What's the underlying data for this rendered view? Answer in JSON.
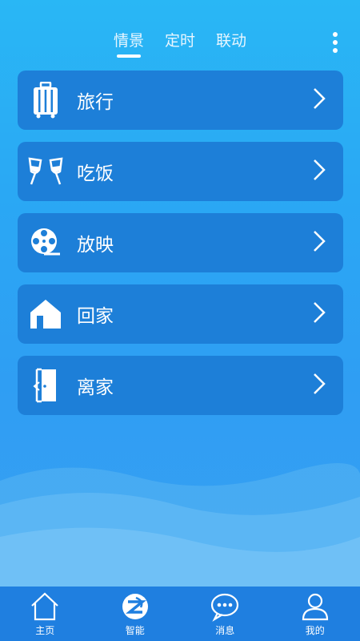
{
  "tabs": [
    {
      "label": "情景",
      "active": true
    },
    {
      "label": "定时",
      "active": false
    },
    {
      "label": "联动",
      "active": false
    }
  ],
  "scenes": [
    {
      "label": "旅行",
      "icon": "luggage-icon"
    },
    {
      "label": "吃饭",
      "icon": "wine-glasses-icon"
    },
    {
      "label": "放映",
      "icon": "film-reel-icon"
    },
    {
      "label": "回家",
      "icon": "house-icon"
    },
    {
      "label": "离家",
      "icon": "door-exit-icon"
    }
  ],
  "bottom_nav": [
    {
      "label": "主页",
      "icon": "home-icon"
    },
    {
      "label": "智能",
      "icon": "smart-icon",
      "active": true
    },
    {
      "label": "消息",
      "icon": "message-icon"
    },
    {
      "label": "我的",
      "icon": "user-icon"
    }
  ],
  "colors": {
    "card": "#1d7fd8",
    "nav": "#1f7fe0"
  }
}
